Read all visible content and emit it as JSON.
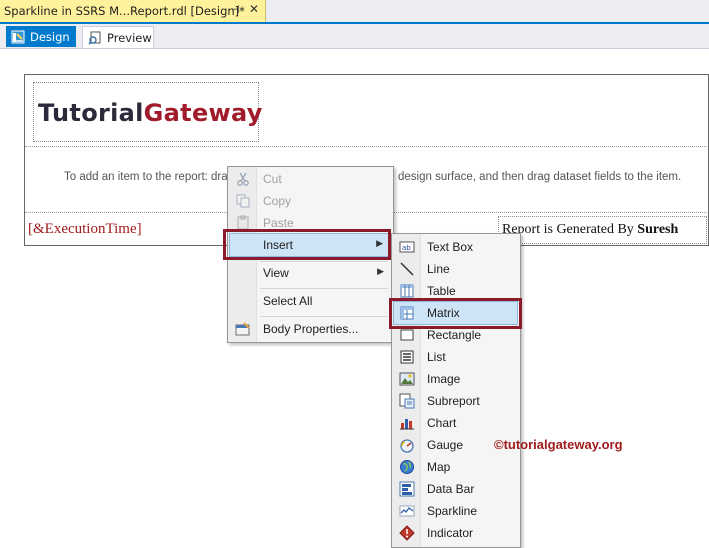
{
  "document_tab": {
    "title": "Sparkline in SSRS M...Report.rdl [Design]*",
    "pin_glyph": "⊣",
    "close_glyph": "✕"
  },
  "view_tabs": [
    {
      "label": "Design",
      "active": true
    },
    {
      "label": "Preview",
      "active": false
    }
  ],
  "report": {
    "logo_part1": "Tutorial",
    "logo_part2": "Gateway",
    "hint_left": "To add an item to the report: dra",
    "hint_right": "design surface, and then drag dataset fields to the item.",
    "execution_time": "[&ExecutionTime]",
    "generated_prefix": "Report is Generated By ",
    "generated_name": "Suresh"
  },
  "context_menu": {
    "items": [
      {
        "label": "Cut",
        "enabled": false,
        "icon": "scissors-icon"
      },
      {
        "label": "Copy",
        "enabled": false,
        "icon": "copy-icon"
      },
      {
        "label": "Paste",
        "enabled": false,
        "icon": "paste-icon"
      },
      {
        "label": "Insert",
        "enabled": true,
        "submenu": true,
        "highlighted": true
      },
      {
        "label": "View",
        "enabled": true,
        "submenu": true
      },
      {
        "label": "Select All",
        "enabled": true
      },
      {
        "label": "Body Properties...",
        "enabled": true,
        "icon": "properties-icon"
      }
    ]
  },
  "insert_submenu": {
    "items": [
      {
        "label": "Text Box",
        "icon": "textbox-icon"
      },
      {
        "label": "Line",
        "icon": "line-icon"
      },
      {
        "label": "Table",
        "icon": "table-icon"
      },
      {
        "label": "Matrix",
        "icon": "matrix-icon",
        "highlighted": true
      },
      {
        "label": "Rectangle",
        "icon": "rectangle-icon"
      },
      {
        "label": "List",
        "icon": "list-icon"
      },
      {
        "label": "Image",
        "icon": "image-icon"
      },
      {
        "label": "Subreport",
        "icon": "subreport-icon"
      },
      {
        "label": "Chart",
        "icon": "chart-icon"
      },
      {
        "label": "Gauge",
        "icon": "gauge-icon"
      },
      {
        "label": "Map",
        "icon": "map-icon"
      },
      {
        "label": "Data Bar",
        "icon": "databar-icon"
      },
      {
        "label": "Sparkline",
        "icon": "sparkline-icon"
      },
      {
        "label": "Indicator",
        "icon": "indicator-icon"
      }
    ]
  },
  "watermark": "©tutorialgateway.org",
  "colors": {
    "accent": "#007acc",
    "doc_tab": "#fff29d",
    "highlight_frame": "#8b1a2b",
    "brand_red": "#a01c2a"
  }
}
